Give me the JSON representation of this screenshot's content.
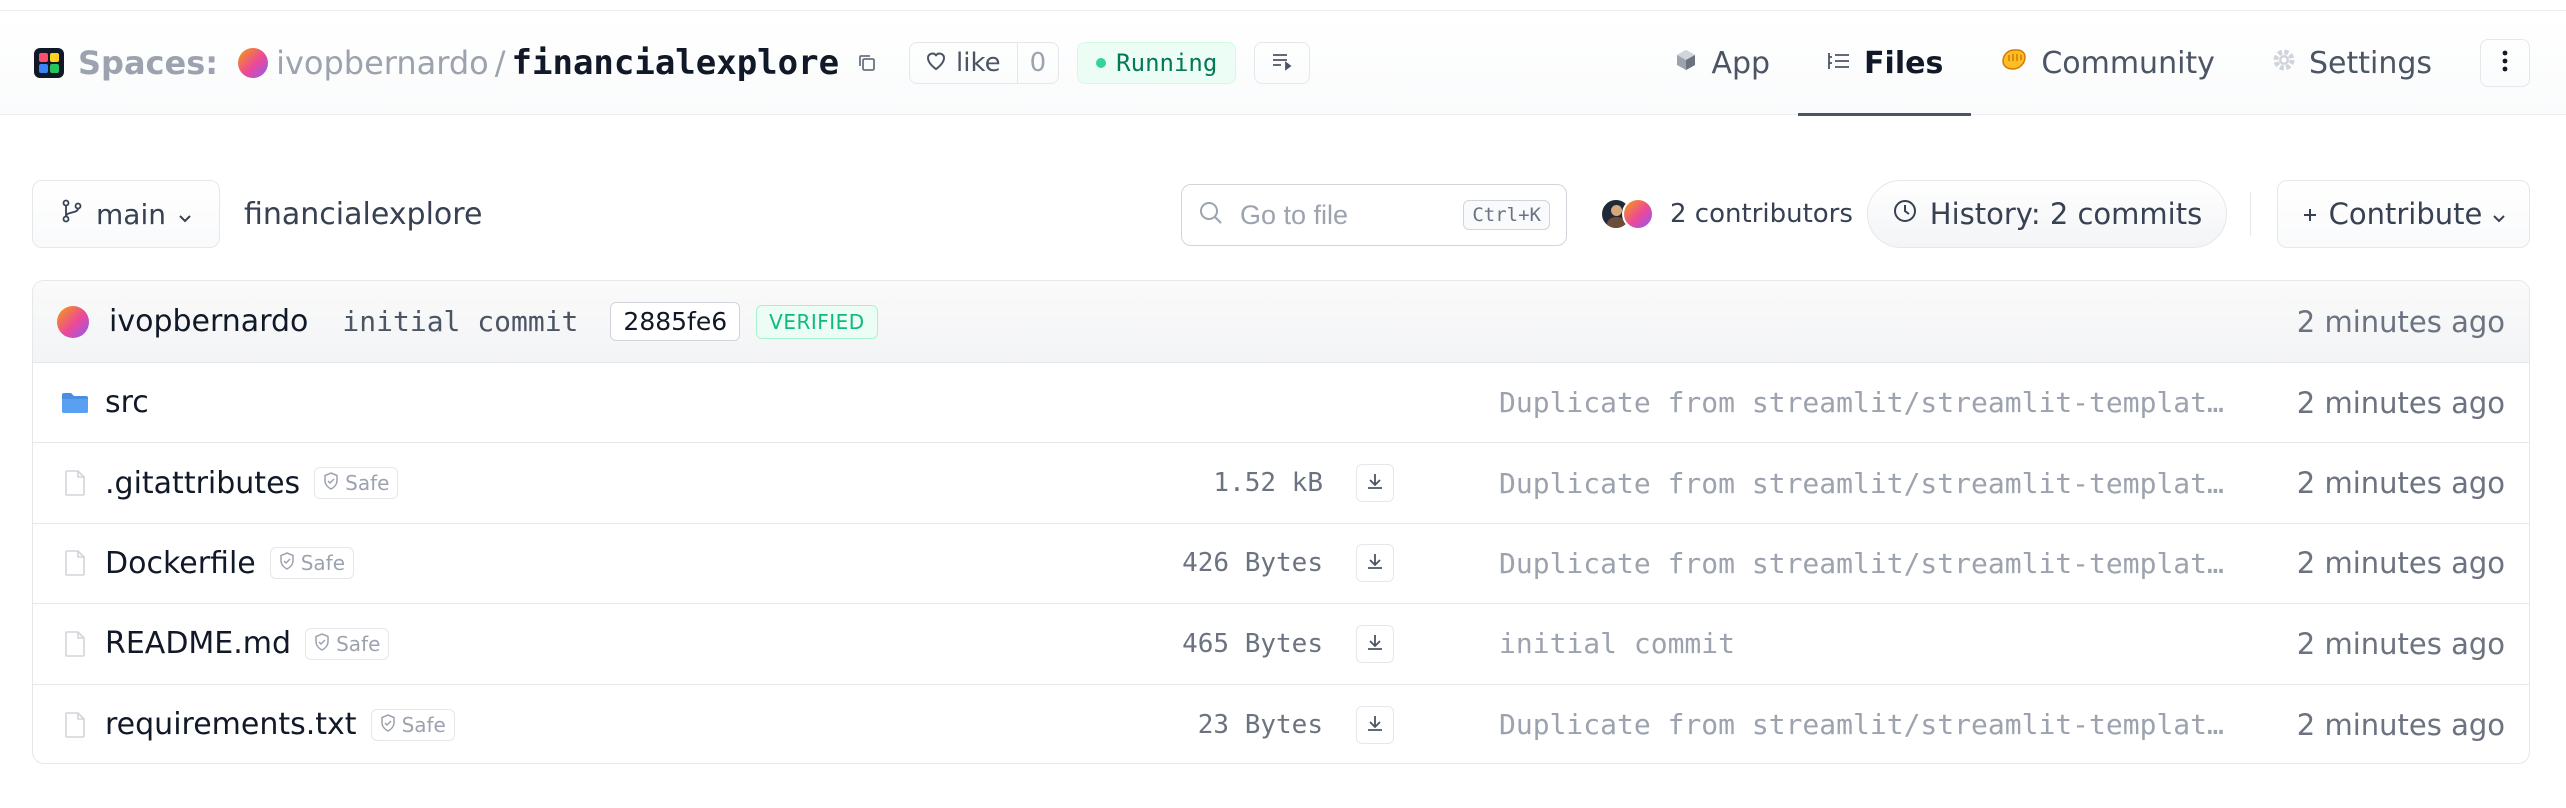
{
  "header": {
    "spaces_label": "Spaces:",
    "owner": "ivopbernardo",
    "repo": "financialexplore",
    "like_label": "like",
    "like_count": "0",
    "status": "Running",
    "tabs": [
      {
        "label": "App",
        "icon": "cube-icon"
      },
      {
        "label": "Files",
        "icon": "files-icon",
        "active": true
      },
      {
        "label": "Community",
        "icon": "community-icon"
      },
      {
        "label": "Settings",
        "icon": "gear-icon"
      }
    ]
  },
  "toolbar": {
    "branch": "main",
    "path": "financialexplore",
    "search_placeholder": "Go to file",
    "shortcut": "Ctrl+K",
    "contributors": "2 contributors",
    "history": "History: 2 commits",
    "contribute": "Contribute"
  },
  "commit": {
    "author": "ivopbernardo",
    "message": "initial commit",
    "hash": "2885fe6",
    "verified": "VERIFIED",
    "time": "2 minutes ago"
  },
  "files": [
    {
      "type": "folder",
      "name": "src",
      "size": "",
      "safe": "",
      "message": "Duplicate from streamlit/streamlit-template-space",
      "time": "2 minutes ago"
    },
    {
      "type": "file",
      "name": ".gitattributes",
      "size": "1.52 kB",
      "safe": "Safe",
      "message": "Duplicate from streamlit/streamlit-template-space",
      "time": "2 minutes ago"
    },
    {
      "type": "file",
      "name": "Dockerfile",
      "size": "426 Bytes",
      "safe": "Safe",
      "message": "Duplicate from streamlit/streamlit-template-space",
      "time": "2 minutes ago"
    },
    {
      "type": "file",
      "name": "README.md",
      "size": "465 Bytes",
      "safe": "Safe",
      "message": "initial commit",
      "time": "2 minutes ago"
    },
    {
      "type": "file",
      "name": "requirements.txt",
      "size": "23 Bytes",
      "safe": "Safe",
      "message": "Duplicate from streamlit/streamlit-template-space",
      "time": "2 minutes ago"
    }
  ],
  "colors": {
    "accent_green": "#10b981",
    "folder_blue": "#4a90e2",
    "text_muted": "#6b7280"
  }
}
